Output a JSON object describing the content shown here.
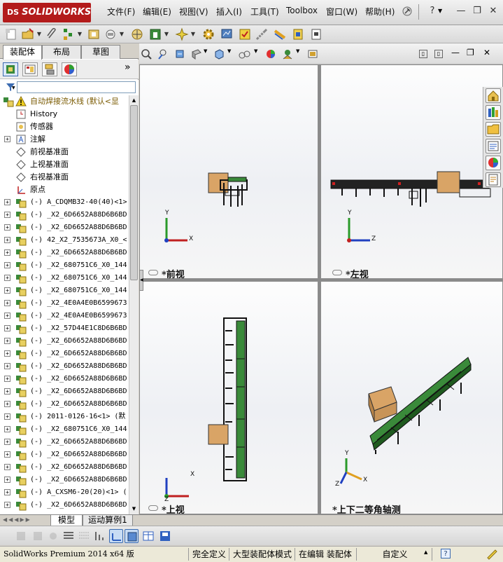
{
  "app": {
    "logo_text": "SOLIDWORKS",
    "logo_prefix": "DS"
  },
  "menu": [
    "文件(F)",
    "编辑(E)",
    "视图(V)",
    "插入(I)",
    "工具(T)",
    "Toolbox",
    "窗口(W)",
    "帮助(H)"
  ],
  "title_controls": {
    "help": "?",
    "minimize": "—",
    "restore": "❐",
    "close": "✕"
  },
  "feature_manager": {
    "tabs": [
      "装配体",
      "布局",
      "草图"
    ],
    "expand_chevron": "»",
    "tree": [
      {
        "label": "自动焊接流水线  (默认<显",
        "type": "assembly-root",
        "expandable": false
      },
      {
        "label": "History",
        "type": "history",
        "expandable": false
      },
      {
        "label": "传感器",
        "type": "sensor",
        "expandable": false
      },
      {
        "label": "注解",
        "type": "annotation",
        "expandable": true
      },
      {
        "label": "前视基准面",
        "type": "plane",
        "expandable": false
      },
      {
        "label": "上视基准面",
        "type": "plane",
        "expandable": false
      },
      {
        "label": "右视基准面",
        "type": "plane",
        "expandable": false
      },
      {
        "label": "原点",
        "type": "origin",
        "expandable": false
      },
      {
        "label": "(-) A_CDQMB32-40(40)<1>",
        "type": "component",
        "expandable": true
      },
      {
        "label": "(-) _X2_6D6652A88D6B6BD",
        "type": "component",
        "expandable": true
      },
      {
        "label": "(-) _X2_6D6652A88D6B6BD",
        "type": "component",
        "expandable": true
      },
      {
        "label": "(-) 42_X2_7535673A_X0_<",
        "type": "component",
        "expandable": true
      },
      {
        "label": "(-) _X2_6D6652A88D6B6BD",
        "type": "component",
        "expandable": true
      },
      {
        "label": "(-) _X2_680751C6_X0_144",
        "type": "component",
        "expandable": true
      },
      {
        "label": "(-) _X2_680751C6_X0_144",
        "type": "component",
        "expandable": true
      },
      {
        "label": "(-) _X2_680751C6_X0_144",
        "type": "component",
        "expandable": true
      },
      {
        "label": "(-) _X2_4E0A4E0B6599673",
        "type": "component",
        "expandable": true
      },
      {
        "label": "(-) _X2_4E0A4E0B6599673",
        "type": "component",
        "expandable": true
      },
      {
        "label": "(-) _X2_57D44E1C8D6B6BD",
        "type": "component",
        "expandable": true
      },
      {
        "label": "(-) _X2_6D6652A88D6B6BD",
        "type": "component",
        "expandable": true
      },
      {
        "label": "(-) _X2_6D6652A88D6B6BD",
        "type": "component",
        "expandable": true
      },
      {
        "label": "(-) _X2_6D6652A88D6B6BD",
        "type": "component",
        "expandable": true
      },
      {
        "label": "(-) _X2_6D6652A88D6B6BD",
        "type": "component",
        "expandable": true
      },
      {
        "label": "(-) _X2_6D6652A88D6B6BD",
        "type": "component",
        "expandable": true
      },
      {
        "label": "(-) _X2_6D6652A88D6B6BD",
        "type": "component",
        "expandable": true
      },
      {
        "label": "(-) 2011-0126-16<1> (默",
        "type": "component",
        "expandable": true
      },
      {
        "label": "(-) _X2_680751C6_X0_144",
        "type": "component",
        "expandable": true
      },
      {
        "label": "(-) _X2_6D6652A88D6B6BD",
        "type": "component",
        "expandable": true
      },
      {
        "label": "(-) _X2_6D6652A88D6B6BD",
        "type": "component",
        "expandable": true
      },
      {
        "label": "(-) _X2_6D6652A88D6B6BD",
        "type": "component",
        "expandable": true
      },
      {
        "label": "(-) _X2_6D6652A88D6B6BD",
        "type": "component",
        "expandable": true
      },
      {
        "label": "(-) A_CXSM6-20(20)<1> (",
        "type": "component",
        "expandable": true
      },
      {
        "label": "(-) _X2_6D6652A88D6B6BD",
        "type": "component",
        "expandable": true
      }
    ]
  },
  "viewports": [
    {
      "id": "front",
      "label": "*前视",
      "axes": [
        "Y",
        "X"
      ]
    },
    {
      "id": "left",
      "label": "*左视",
      "axes": [
        "Y",
        "Z"
      ]
    },
    {
      "id": "top",
      "label": "*上视",
      "axes": [
        "X",
        "Z"
      ]
    },
    {
      "id": "iso",
      "label": "*上下二等角轴测",
      "axes": [
        "Y",
        "X",
        "Z"
      ]
    }
  ],
  "bottom_tabs": [
    "模型",
    "运动算例1"
  ],
  "status_bar": {
    "app_version": "SolidWorks Premium 2014 x64 版",
    "cells": [
      "完全定义",
      "大型装配体模式",
      "在编辑 装配体",
      "自定义"
    ],
    "help": "?"
  },
  "colors": {
    "accent_red": "#b31b1b",
    "part_green": "#3a8a3a",
    "part_tan": "#d9a466"
  }
}
